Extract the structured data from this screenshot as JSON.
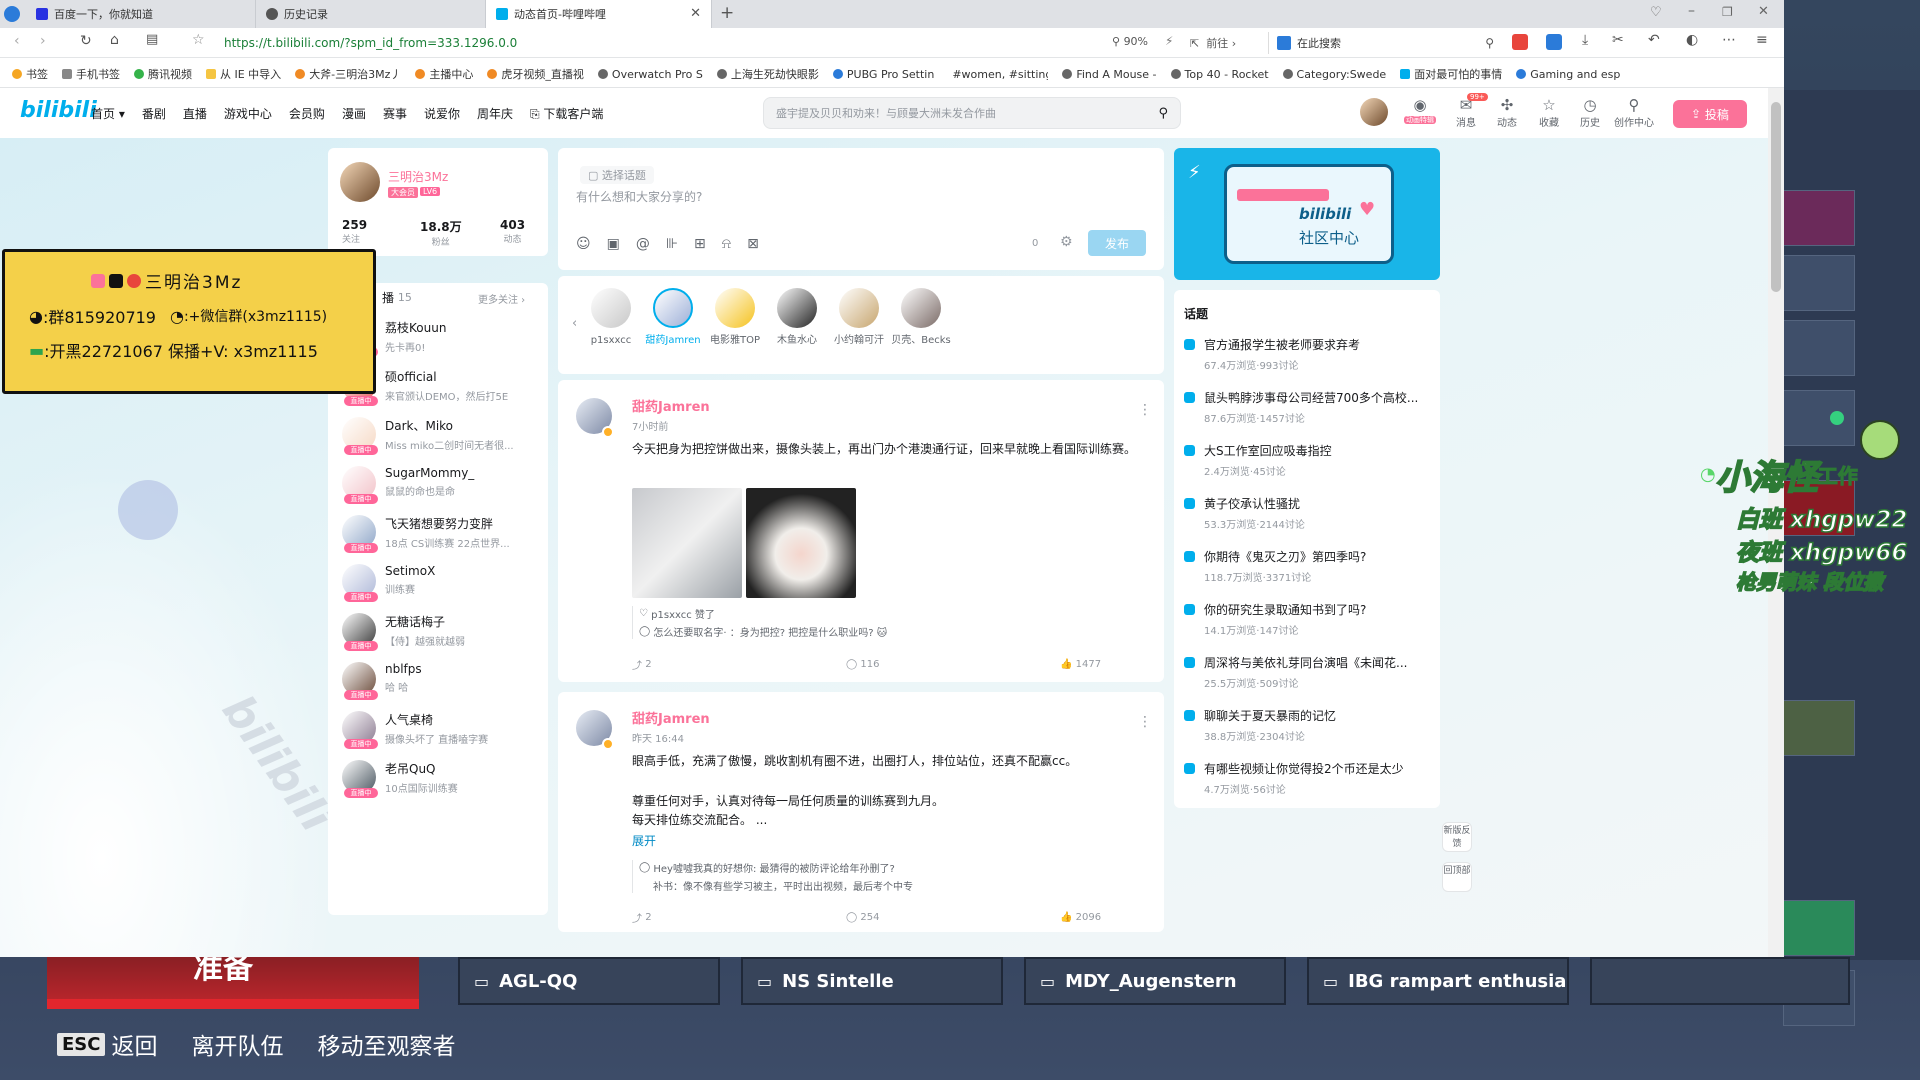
{
  "tabs": [
    {
      "title": "百度一下，你就知道",
      "color": "#2932e1"
    },
    {
      "title": "历史记录",
      "color": "#555"
    },
    {
      "title": "动态首页-哔哩哔哩",
      "color": "#00aeec"
    }
  ],
  "address": {
    "url": "https://t.bilibili.com/?spm_id_from=333.1296.0.0",
    "zoom": "90%",
    "go": "前往",
    "search_placeholder": "在此搜索"
  },
  "bookmarks": [
    "书签",
    "手机书签",
    "腾讯视频",
    "从 IE 中导入",
    "大斧-三明治3Mz丿",
    "主播中心",
    "虎牙视频_直播视",
    "Overwatch Pro S",
    "上海生死劫快眼影",
    "PUBG Pro Settin",
    "#women, #sitting",
    "Find A Mouse -",
    "Top 40 - Rocket",
    "Category:Swede",
    "面对最可怕的事情",
    "Gaming and esp"
  ],
  "nav": {
    "logo": "bilibili",
    "links": [
      "首页",
      "番剧",
      "直播",
      "游戏中心",
      "会员购",
      "漫画",
      "赛事",
      "说爱你",
      "周年庆",
      "下载客户端"
    ],
    "search_placeholder": "盛宇提及贝贝和劝来！与顾曼大洲未发合作曲",
    "icons": [
      {
        "label": "动画特辑",
        "glyph": "◉"
      },
      {
        "label": "消息",
        "glyph": "✉",
        "badge": "99+"
      },
      {
        "label": "动态",
        "glyph": "✣"
      },
      {
        "label": "收藏",
        "glyph": "☆"
      },
      {
        "label": "历史",
        "glyph": "◷"
      },
      {
        "label": "创作中心",
        "glyph": "⚲"
      }
    ],
    "upload": "投稿"
  },
  "profile": {
    "name": "三明治3Mz",
    "badge": "大会员",
    "level": "LV6",
    "stats": [
      {
        "value": "259",
        "label": "关注"
      },
      {
        "value": "18.8万",
        "label": "粉丝"
      },
      {
        "value": "403",
        "label": "动态"
      }
    ]
  },
  "live_list": {
    "title_suffix": "播",
    "count": "15",
    "more": "更多关注 ›",
    "live_tag": "直播中",
    "items": [
      {
        "name": "荔枝Kouun",
        "desc": "先卡再0!"
      },
      {
        "name": "硕official",
        "desc": "来官颁认DEMO，然后打5E"
      },
      {
        "name": "Dark、Miko",
        "desc": "Miss miko二创时间无者很..."
      },
      {
        "name": "SugarMommy_",
        "desc": "鼠鼠的命也是命"
      },
      {
        "name": "飞天猪想要努力变胖",
        "desc": "18点 CS训练赛 22点世界..."
      },
      {
        "name": "SetimoX",
        "desc": "训练赛"
      },
      {
        "name": "无糖话梅子",
        "desc": "【侍】越强就越弱"
      },
      {
        "name": "nblfps",
        "desc": "哈 哈"
      },
      {
        "name": "人气桌椅",
        "desc": "摄像头坏了 直播嗑字赛"
      },
      {
        "name": "老吊QuQ",
        "desc": "10点国际训练赛"
      }
    ]
  },
  "composer": {
    "topic": "选择话题",
    "placeholder": "有什么想和大家分享的?",
    "count": "0",
    "publish": "发布"
  },
  "following": [
    {
      "name": "p1sxxcc"
    },
    {
      "name": "甜药Jamren"
    },
    {
      "name": "电影雅TOP"
    },
    {
      "name": "木鱼水心"
    },
    {
      "name": "小约翰可汗"
    },
    {
      "name": "贝壳、Becks"
    }
  ],
  "posts": [
    {
      "author": "甜药Jamren",
      "time": "7小时前",
      "text": "今天把身为把控饼做出来，摄像头装上，再出门办个港澳通行证，回来早就晚上看国际训练赛。",
      "liked_by": "p1sxxcc 赞了",
      "comment": "怎么还要取名字· ：身为把控? 把控是什么职业吗? 🐱",
      "shares": "2",
      "comments": "116",
      "likes": "1477"
    },
    {
      "author": "甜药Jamren",
      "time": "昨天 16:44",
      "text": "眼高手低，充满了傲慢，跳收割机有圈不进，出圈打人，排位站位，还真不配赢cc。",
      "text2": "尊重任何对手，认真对待每一局任何质量的训练赛到九月。",
      "text3": "每天排位练交流配合。 ...",
      "expand": "展开",
      "comment": "Hey噓噓我真的好想你: 最猜得的被防评论给年孙删了?",
      "comment2": "补书：像不像有些学习被主，平时出出视频，最后考个中专",
      "shares": "2",
      "comments": "254",
      "likes": "2096"
    }
  ],
  "side": {
    "banner": "社区中心",
    "banner_logo": "bilibili",
    "topics_title": "话题",
    "topics": [
      {
        "title": "官方通报学生被老师要求弃考",
        "stats": "67.4万浏览·993讨论"
      },
      {
        "title": "鼠头鸭脖涉事母公司经营700多个高校...",
        "stats": "87.6万浏览·1457讨论"
      },
      {
        "title": "大S工作室回应吸毒指控",
        "stats": "2.4万浏览·45讨论"
      },
      {
        "title": "黄子佼承认性骚扰",
        "stats": "53.3万浏览·2144讨论"
      },
      {
        "title": "你期待《鬼灭之刃》第四季吗?",
        "stats": "118.7万浏览·3371讨论"
      },
      {
        "title": "你的研究生录取通知书到了吗?",
        "stats": "14.1万浏览·147讨论"
      },
      {
        "title": "周深将与美依礼芽同台演唱《未闻花...",
        "stats": "25.5万浏览·509讨论"
      },
      {
        "title": "聊聊关于夏天暴雨的记忆",
        "stats": "38.8万浏览·2304讨论"
      },
      {
        "title": "有哪些视频让你觉得投2个币还是太少",
        "stats": "4.7万浏览·56讨论"
      }
    ],
    "float_buttons": [
      "新版反馈",
      "回顶部"
    ]
  },
  "stream_overlay": {
    "line1": "三明治3Mz",
    "line2_a": ":群815920719",
    "line2_b": ":+微信群(x3mz1115)",
    "line3": ":开黑22721067  保播+V: x3mz1115"
  },
  "right_overlay": {
    "name": "小海怪",
    "suffix": "工作",
    "line1": "白班 xhgpw22",
    "line2": "夜班 xhgpw66",
    "line3": "枪男萌妹 段位撒"
  },
  "game": {
    "banner_text": "准备",
    "players": [
      "AGL-QQ",
      "NS Sintelle",
      "MDY_Augenstern",
      "IBG rampart enthusiast",
      ""
    ],
    "esc_key": "ESC",
    "esc_label": "返回",
    "leave": "离开队伍",
    "observer": "移动至观察者"
  },
  "colors": {
    "accent": "#fb7299",
    "blue": "#00aeec"
  }
}
